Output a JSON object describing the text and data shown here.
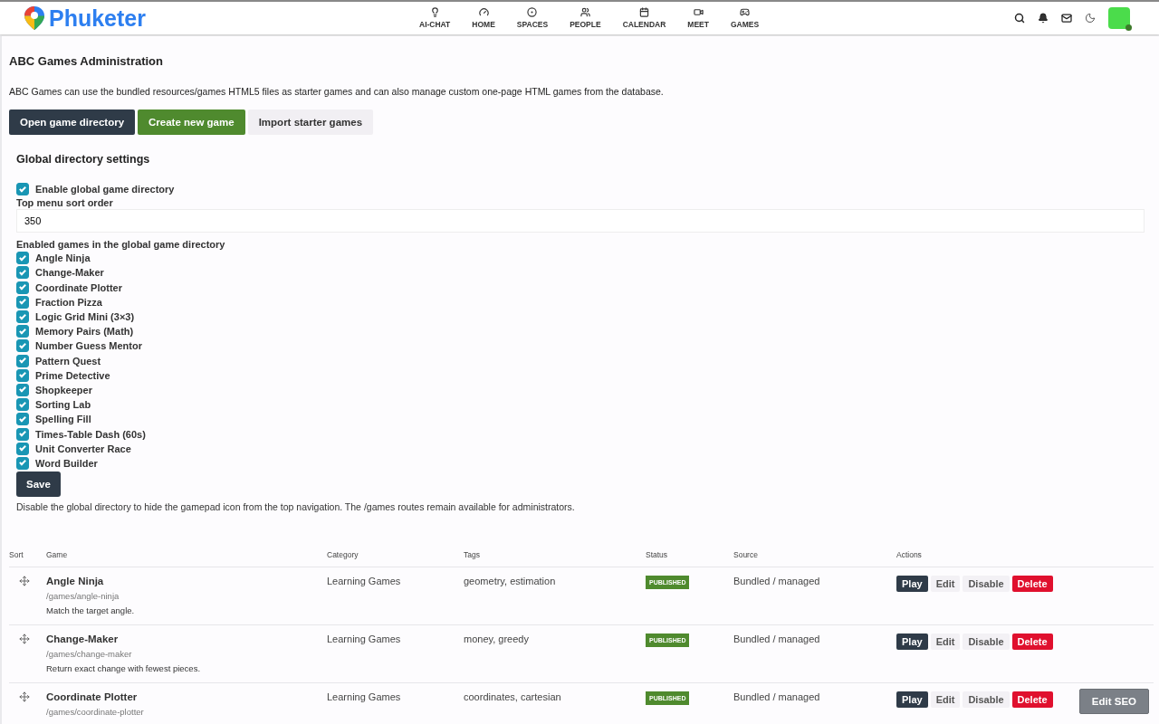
{
  "brand": "Phuketer",
  "nav": [
    {
      "label": "AI-CHAT",
      "kind": "bulb"
    },
    {
      "label": "HOME",
      "kind": "gauge"
    },
    {
      "label": "SPACES",
      "kind": "target"
    },
    {
      "label": "PEOPLE",
      "kind": "users"
    },
    {
      "label": "CALENDAR",
      "kind": "calendar"
    },
    {
      "label": "MEET",
      "kind": "video"
    },
    {
      "label": "GAMES",
      "kind": "gamepad"
    }
  ],
  "title": "ABC Games Administration",
  "intro": "ABC Games can use the bundled resources/games HTML5 files as starter games and can also manage custom one-page HTML games from the database.",
  "top_buttons": [
    {
      "label": "Open game directory",
      "kind": "dark"
    },
    {
      "label": "Create new game",
      "kind": "green"
    },
    {
      "label": "Import starter games",
      "kind": "light"
    }
  ],
  "settings": {
    "heading": "Global directory settings",
    "enable": {
      "label": "Enable global game directory",
      "checked": true
    },
    "sort_label": "Top menu sort order",
    "sort_value": "350",
    "games_label": "Enabled games in the global game directory",
    "games": [
      {
        "label": "Angle Ninja",
        "checked": true
      },
      {
        "label": "Change-Maker",
        "checked": true
      },
      {
        "label": "Coordinate Plotter",
        "checked": true
      },
      {
        "label": "Fraction Pizza",
        "checked": true
      },
      {
        "label": "Logic Grid Mini (3×3)",
        "checked": true
      },
      {
        "label": "Memory Pairs (Math)",
        "checked": true
      },
      {
        "label": "Number Guess Mentor",
        "checked": true
      },
      {
        "label": "Pattern Quest",
        "checked": true
      },
      {
        "label": "Prime Detective",
        "checked": true
      },
      {
        "label": "Shopkeeper",
        "checked": true
      },
      {
        "label": "Sorting Lab",
        "checked": true
      },
      {
        "label": "Spelling Fill",
        "checked": true
      },
      {
        "label": "Times-Table Dash (60s)",
        "checked": true
      },
      {
        "label": "Unit Converter Race",
        "checked": true
      },
      {
        "label": "Word Builder",
        "checked": true
      }
    ],
    "save": "Save",
    "note": "Disable the global directory to hide the gamepad icon from the top navigation. The /games routes remain available for administrators."
  },
  "table": {
    "columns": [
      "Sort",
      "Game",
      "Category",
      "Tags",
      "Status",
      "Source",
      "Actions"
    ],
    "rows": [
      {
        "name": "Angle Ninja",
        "path": "/games/angle-ninja",
        "description": "Match the target angle.",
        "category": "Learning Games",
        "tags": "geometry, estimation",
        "status": "PUBLISHED",
        "source": "Bundled / managed",
        "actions": [
          "Play",
          "Edit",
          "Disable",
          "Delete"
        ]
      },
      {
        "name": "Change-Maker",
        "path": "/games/change-maker",
        "description": "Return exact change with fewest pieces.",
        "category": "Learning Games",
        "tags": "money, greedy",
        "status": "PUBLISHED",
        "source": "Bundled / managed",
        "actions": [
          "Play",
          "Edit",
          "Disable",
          "Delete"
        ]
      },
      {
        "name": "Coordinate Plotter",
        "path": "/games/coordinate-plotter",
        "category": "Learning Games",
        "tags": "coordinates, cartesian",
        "status": "PUBLISHED",
        "source": "Bundled / managed",
        "actions": [
          "Play",
          "Edit",
          "Disable",
          "Delete"
        ]
      }
    ]
  },
  "floating_button": "Edit SEO"
}
